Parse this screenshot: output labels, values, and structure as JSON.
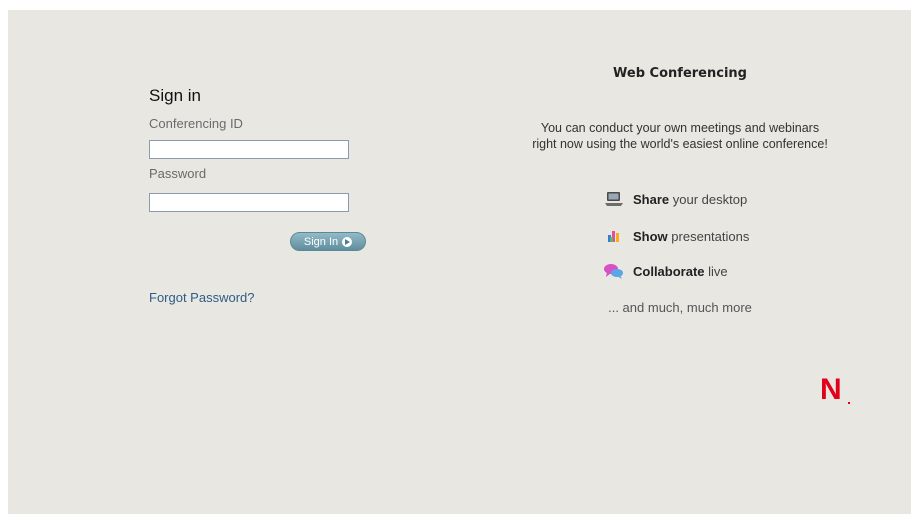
{
  "signin": {
    "title": "Sign in",
    "conferencing_id_label": "Conferencing ID",
    "conferencing_id_value": "",
    "password_label": "Password",
    "password_value": "",
    "button_label": "Sign In",
    "forgot_link": "Forgot Password?"
  },
  "promo": {
    "title": "Web Conferencing",
    "description": "You can conduct your own meetings and webinars right now using the world's easiest online conference!",
    "features": [
      {
        "icon": "monitor-icon",
        "bold": "Share",
        "rest": "your desktop"
      },
      {
        "icon": "presentation-icon",
        "bold": "Show",
        "rest": "presentations"
      },
      {
        "icon": "chat-bubbles-icon",
        "bold": "Collaborate",
        "rest": "live"
      }
    ],
    "more": "... and much, much more"
  },
  "brand": {
    "logo_letter": "N",
    "accent_color": "#e2001a"
  }
}
